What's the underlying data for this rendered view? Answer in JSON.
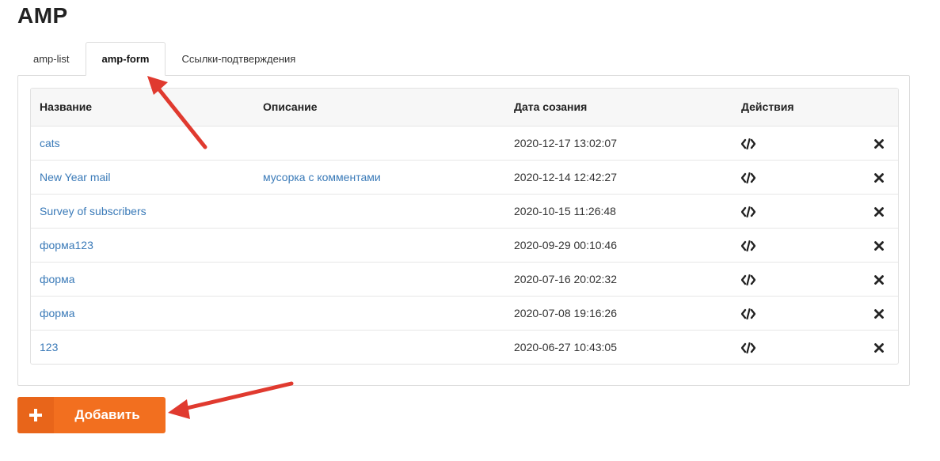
{
  "page": {
    "title": "AMP"
  },
  "tabs": [
    {
      "label": "amp-list",
      "active": false
    },
    {
      "label": "amp-form",
      "active": true
    },
    {
      "label": "Ссылки-подтверждения",
      "active": false
    }
  ],
  "table": {
    "headers": {
      "name": "Название",
      "description": "Описание",
      "created": "Дата созания",
      "actions": "Действия"
    },
    "rows": [
      {
        "name": "cats",
        "description": "",
        "created": "2020-12-17 13:02:07"
      },
      {
        "name": "New Year mail",
        "description": "мусорка с комментами",
        "created": "2020-12-14 12:42:27"
      },
      {
        "name": "Survey of subscribers",
        "description": "",
        "created": "2020-10-15 11:26:48"
      },
      {
        "name": "форма123",
        "description": "",
        "created": "2020-09-29 00:10:46"
      },
      {
        "name": "форма",
        "description": "",
        "created": "2020-07-16 20:02:32"
      },
      {
        "name": "форма",
        "description": "",
        "created": "2020-07-08 19:16:26"
      },
      {
        "name": "123",
        "description": "",
        "created": "2020-06-27 10:43:05"
      }
    ],
    "row_icons": {
      "code": "code-icon",
      "delete": "close-icon"
    }
  },
  "add_button": {
    "icon": "plus-icon",
    "label": "Добавить"
  },
  "colors": {
    "accent": "#f26f1f",
    "link": "#3a7ab8",
    "annotation_arrow": "#e03a2f"
  }
}
